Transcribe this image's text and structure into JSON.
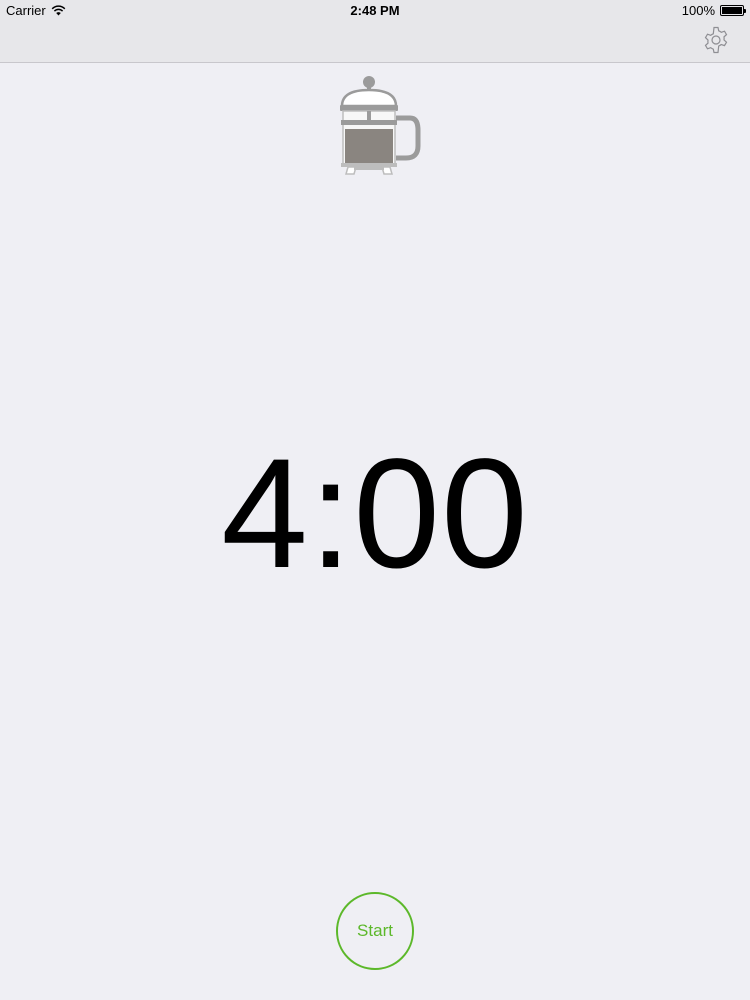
{
  "status_bar": {
    "carrier": "Carrier",
    "time": "2:48 PM",
    "battery": "100%",
    "battery_level": 1.0
  },
  "nav_bar": {
    "settings_icon": "gear-icon"
  },
  "brew_icon": "french-press-icon",
  "timer": {
    "display": "4:00"
  },
  "controls": {
    "start_label": "Start"
  },
  "colors": {
    "accent": "#5cb82a",
    "background": "#efeff4",
    "nav_background": "#e7e7ea",
    "icon_gray": "#9b9b9b",
    "coffee": "#8a8580"
  }
}
